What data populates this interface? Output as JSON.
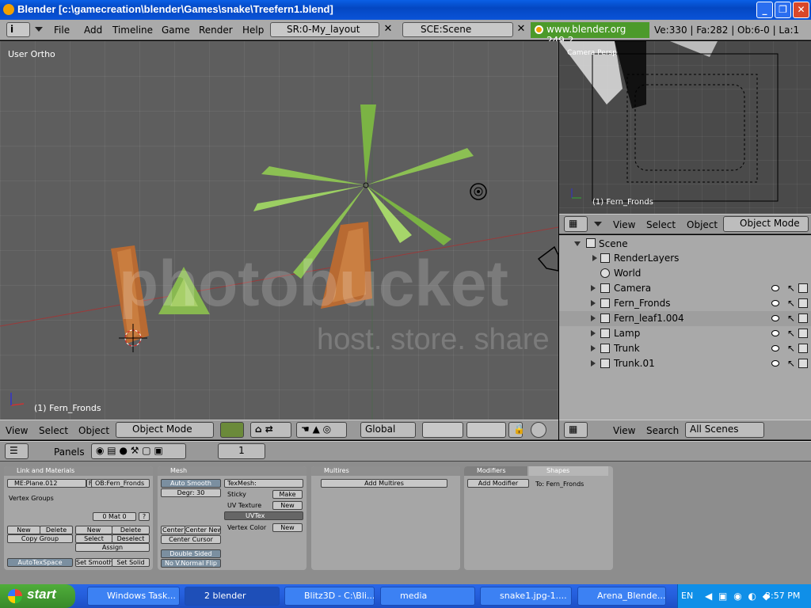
{
  "window": {
    "title": "Blender [c:\\gamecreation\\blender\\Games\\snake\\Treefern1.blend]",
    "controls": [
      "_",
      "❐",
      "✕"
    ]
  },
  "menubar": {
    "info_icon": "i",
    "menus": [
      "File",
      "Add",
      "Timeline",
      "Game",
      "Render",
      "Help"
    ],
    "screen_layout": "SR:0-My_layout",
    "scene": "SCE:Scene",
    "url": "www.blender.org 249.2",
    "stats": "Ve:330 | Fa:282 | Ob:6-0 | La:1"
  },
  "viewport3d": {
    "view_label": "User Ortho",
    "object_label": "(1) Fern_Fronds",
    "header": {
      "menus": [
        "View",
        "Select",
        "Object"
      ],
      "mode": "Object Mode",
      "orientation": "Global"
    }
  },
  "camera_view": {
    "view_label": "Camera Persp",
    "object_label": "(1) Fern_Fronds",
    "header": {
      "menus": [
        "View",
        "Select",
        "Object"
      ],
      "mode": "Object Mode"
    }
  },
  "outliner": {
    "scene": "Scene",
    "items": [
      {
        "label": "RenderLayers"
      },
      {
        "label": "World"
      },
      {
        "label": "Camera"
      },
      {
        "label": "Fern_Fronds"
      },
      {
        "label": "Fern_leaf1.004"
      },
      {
        "label": "Lamp"
      },
      {
        "label": "Trunk"
      },
      {
        "label": "Trunk.01"
      }
    ],
    "header": {
      "menus": [
        "View",
        "Search"
      ],
      "filter": "All Scenes"
    }
  },
  "buttons_window": {
    "header": {
      "label": "Panels",
      "frame": "1"
    },
    "link_materials": {
      "title": "Link and Materials",
      "mesh_name": "ME:Plane.012",
      "f_label": "F",
      "object_name": "OB:Fern_Fronds",
      "vertex_groups": "Vertex Groups",
      "mat_counter": "0 Mat 0",
      "question": "?",
      "buttons": [
        "New",
        "Delete",
        "Copy Group",
        "New",
        "Delete",
        "Select",
        "Deselect",
        "Assign",
        "AutoTexSpace",
        "Set Smooth",
        "Set Solid"
      ]
    },
    "mesh": {
      "title": "Mesh",
      "auto_smooth": "Auto Smooth",
      "degr": "Degr: 30",
      "texmesh": "TexMesh:",
      "sticky": "Sticky",
      "make": "Make",
      "uv_texture": "UV Texture",
      "new": "New",
      "uvtex": "UVTex",
      "vertex_color": "Vertex Color",
      "new2": "New",
      "center": "Center",
      "center_new": "Center New",
      "center_cursor": "Center Cursor",
      "double_sided": "Double Sided",
      "no_v_normal_flip": "No V.Normal Flip"
    },
    "multires": {
      "title": "Multires",
      "add": "Add Multires"
    },
    "modifiers": {
      "tab_modifiers": "Modifiers",
      "tab_shapes": "Shapes",
      "add_modifier": "Add Modifier",
      "to_label": "To: Fern_Fronds"
    }
  },
  "taskbar": {
    "start": "start",
    "tasks": [
      "Windows Task...",
      "2 blender",
      "Blitz3D - C:\\Bli...",
      "media",
      "snake1.jpg-1....",
      "Arena_Blende..."
    ],
    "lang": "EN",
    "clock": "3:57 PM"
  },
  "watermark": {
    "line1": "photobucket",
    "line2": "host. store. share"
  }
}
